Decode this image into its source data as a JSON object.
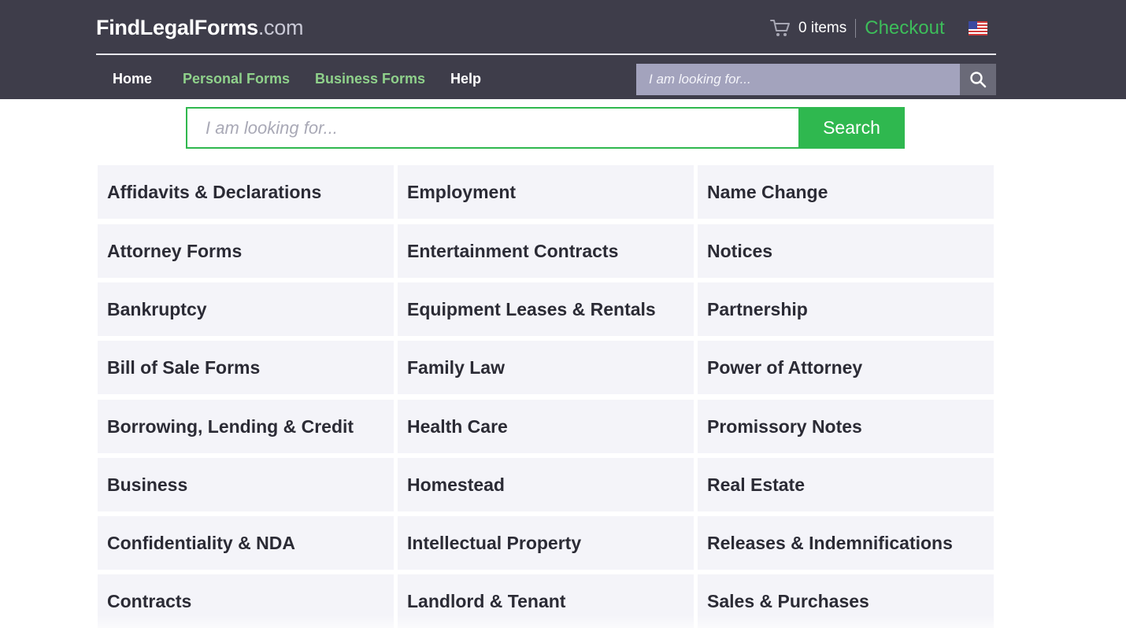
{
  "header": {
    "logo_main": "FindLegalForms",
    "logo_tld": ".com",
    "cart_count": "0 items",
    "checkout_label": "Checkout",
    "flag_icon": "us-flag-icon",
    "cart_icon": "cart-icon"
  },
  "nav": {
    "items": [
      {
        "label": "Home",
        "color": "#ffffff"
      },
      {
        "label": "Personal Forms",
        "color": "#8fd18b"
      },
      {
        "label": "Business Forms",
        "color": "#8fd18b"
      },
      {
        "label": "Help",
        "color": "#ffffff"
      }
    ],
    "search_placeholder": "I am looking for...",
    "search_icon": "magnifier-icon"
  },
  "main_search": {
    "placeholder": "I am looking for...",
    "button_label": "Search"
  },
  "categories": {
    "columns": [
      [
        "Affidavits & Declarations",
        "Attorney Forms",
        "Bankruptcy",
        "Bill of Sale Forms",
        "Borrowing, Lending & Credit",
        "Business",
        "Confidentiality & NDA",
        "Contracts"
      ],
      [
        "Employment",
        "Entertainment Contracts",
        "Equipment Leases & Rentals",
        "Family Law",
        "Health Care",
        "Homestead",
        "Intellectual Property",
        "Landlord & Tenant"
      ],
      [
        "Name Change",
        "Notices",
        "Partnership",
        "Power of Attorney",
        "Promissory Notes",
        "Real Estate",
        "Releases & Indemnifications",
        "Sales & Purchases"
      ]
    ]
  },
  "colors": {
    "header_bg": "#3e3d4a",
    "accent_green": "#2fb84f",
    "tile_bg": "#f4f4f9"
  }
}
